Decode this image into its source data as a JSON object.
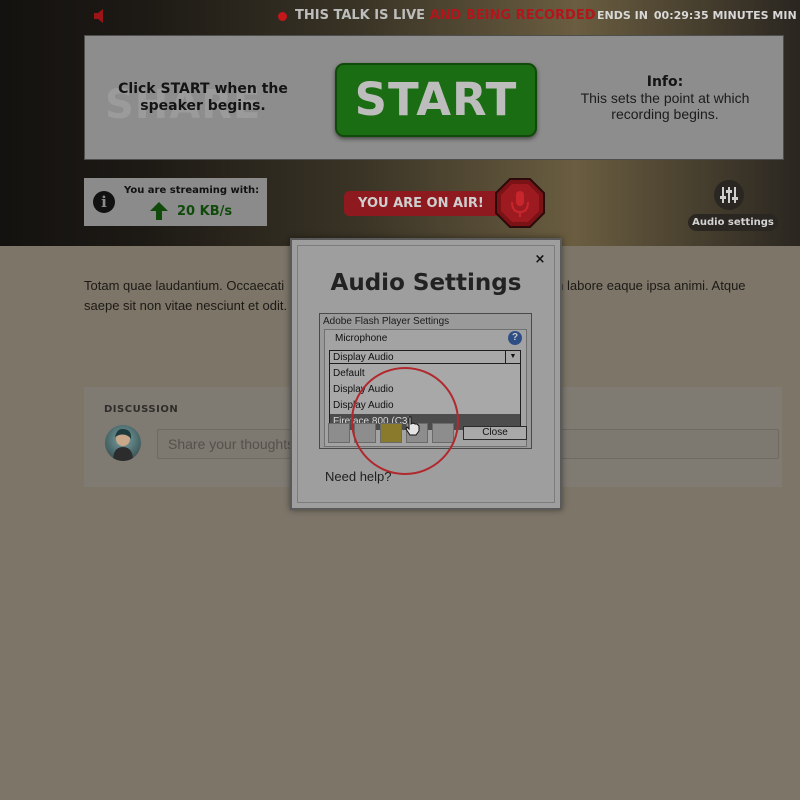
{
  "header": {
    "live_label": "THIS TALK IS LIVE",
    "recording_label": "AND BEING RECORDED",
    "ends_label": "ENDS IN",
    "countdown": "00:29:35 MINUTES MIN"
  },
  "recording_panel": {
    "background_word": "SHARE",
    "instruction": "Click START when the speaker begins.",
    "start_button": "START",
    "info_title": "Info:",
    "info_body": "This sets the point at which recording begins."
  },
  "streaming": {
    "label": "You are streaming with:",
    "rate": "20 KB/s"
  },
  "on_air": {
    "label": "YOU ARE ON AIR!"
  },
  "audio_settings_button": {
    "label": "Audio settings"
  },
  "article": {
    "text_left": "Totam quae laudantium. Occaecati",
    "text_right": "n labore eaque ipsa animi. Atque",
    "text_line2": "saepe sit non vitae nesciunt et odit."
  },
  "discussion": {
    "title": "DISCUSSION",
    "input_placeholder": "Share your thoughts"
  },
  "modal": {
    "title": "Audio Settings",
    "close_symbol": "×",
    "help_link": "Need help?",
    "flash": {
      "title": "Adobe Flash Player Settings",
      "device_type": "Microphone",
      "selected": "Display Audio",
      "options": [
        "Default",
        "Display Audio",
        "Display Audio",
        "Fireface 800 (C3)"
      ],
      "highlighted_index": 3,
      "close_button": "Close",
      "help_symbol": "?"
    }
  },
  "colors": {
    "accent_red": "#b3151b",
    "start_green": "#1a6d13",
    "rate_green": "#0f4a0a"
  },
  "icons": [
    "speaker-icon",
    "live-dot-icon",
    "info-icon",
    "up-arrow-icon",
    "microphone-icon",
    "sliders-icon",
    "close-icon",
    "help-icon",
    "dropdown-arrow-icon",
    "hand-cursor-icon"
  ]
}
